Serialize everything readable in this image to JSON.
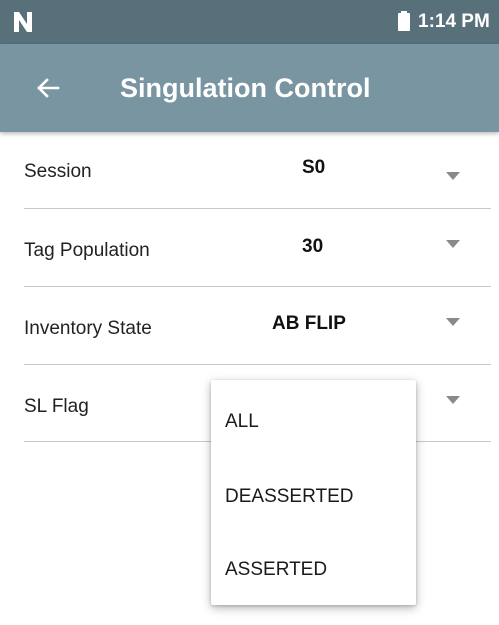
{
  "status_bar": {
    "time": "1:14 PM",
    "icons": [
      "n-logo-icon",
      "battery-icon"
    ]
  },
  "app_bar": {
    "title": "Singulation Control",
    "back_icon": "arrow-left-icon"
  },
  "settings": {
    "session": {
      "label": "Session",
      "value": "S0"
    },
    "tag_population": {
      "label": "Tag Population",
      "value": "30"
    },
    "inventory_state": {
      "label": "Inventory State",
      "value": "AB FLIP"
    },
    "sl_flag": {
      "label": "SL Flag",
      "value": ""
    }
  },
  "sl_flag_dropdown": {
    "options": [
      "ALL",
      "DEASSERTED",
      "ASSERTED"
    ]
  },
  "colors": {
    "status_bar": "#577079",
    "app_bar": "#7995a1",
    "caret": "#8a8a8a",
    "divider": "#c8c8c8"
  }
}
